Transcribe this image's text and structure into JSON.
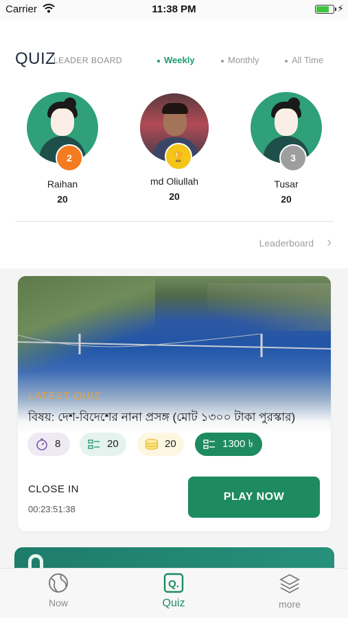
{
  "status_bar": {
    "carrier": "Carrier",
    "time": "11:38 PM",
    "battery_level": 0.7
  },
  "header": {
    "title": "QUIZ",
    "subtitle": "LEADER BOARD",
    "tabs": [
      {
        "label": "Weekly",
        "active": true
      },
      {
        "label": "Monthly",
        "active": false
      },
      {
        "label": "All Time",
        "active": false
      }
    ]
  },
  "leaders": [
    {
      "name": "Raihan",
      "score": "20",
      "rank": "2",
      "badge_color": "#f47b20",
      "avatar": "avatar-illustration"
    },
    {
      "name": "md Oliullah",
      "score": "20",
      "rank": "1",
      "badge_color": "#f5c518",
      "avatar": "photo"
    },
    {
      "name": "Tusar",
      "score": "20",
      "rank": "3",
      "badge_color": "#9e9e9e",
      "avatar": "avatar-illustration"
    }
  ],
  "leaderboard_link": "Leaderboard",
  "latest_quiz": {
    "label": "LATEST QUIZ",
    "subject": "বিষয়: দেশ-বিদেশের নানা প্রসঙ্গ (মোট ১৩০০ টাকা পুরস্কার)",
    "stats": {
      "time": "8",
      "questions": "20",
      "coins": "20",
      "prize": "1300 ৳"
    },
    "close_label": "CLOSE IN",
    "close_time": "00:23:51:38",
    "play_label": "PLAY NOW"
  },
  "bottom_nav": [
    {
      "label": "Now",
      "icon": "globe-icon",
      "active": false
    },
    {
      "label": "Quiz",
      "icon": "quiz-icon",
      "active": true
    },
    {
      "label": "more",
      "icon": "layers-icon",
      "active": false
    }
  ],
  "colors": {
    "accent": "#1e8a60",
    "accent_text": "#1e9b70",
    "orange": "#e3a24a"
  }
}
